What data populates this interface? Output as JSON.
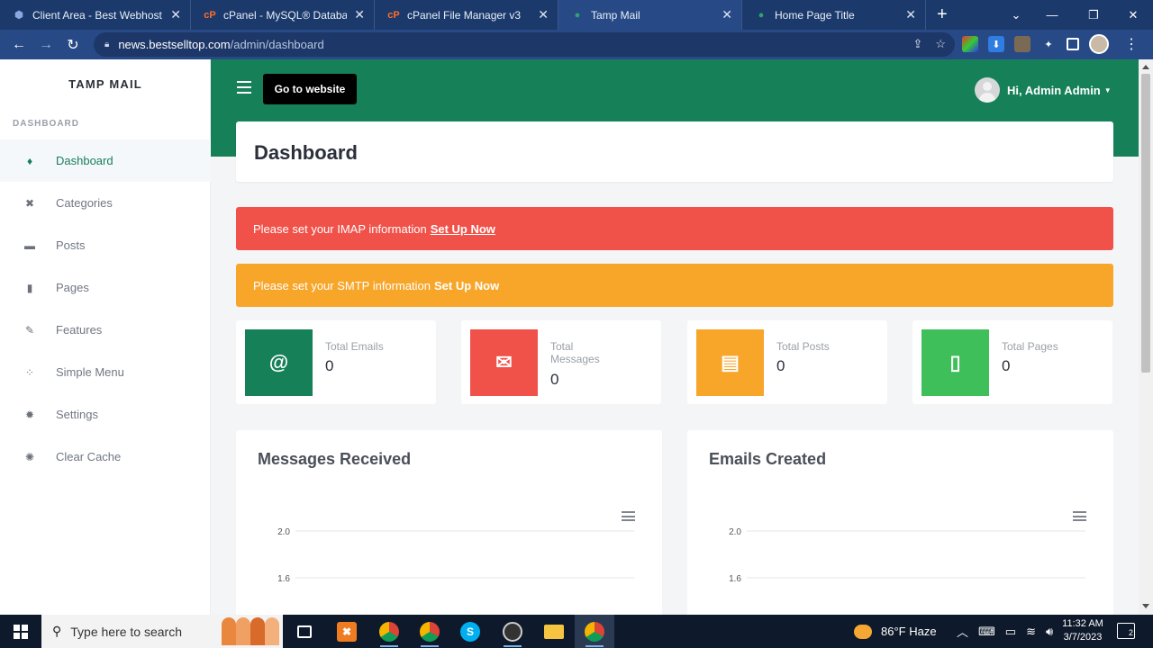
{
  "browser": {
    "tabs": [
      {
        "title": "Client Area - Best Webhost B",
        "icon": "shield-icon",
        "color": "#8aa7e0"
      },
      {
        "title": "cPanel - MySQL® Databases",
        "icon": "cpanel-icon",
        "color": "#ff6c2c"
      },
      {
        "title": "cPanel File Manager v3",
        "icon": "cpanel-icon",
        "color": "#ff6c2c"
      },
      {
        "title": "Tamp Mail",
        "icon": "mail-app-icon",
        "color": "#2fa36b"
      },
      {
        "title": "Home Page Title",
        "icon": "mail-app-icon",
        "color": "#2fa36b"
      }
    ],
    "url_host": "news.bestselltop.com",
    "url_path": "/admin/dashboard"
  },
  "sidebar": {
    "brand": "TAMP MAIL",
    "heading": "DASHBOARD",
    "items": [
      {
        "label": "Dashboard",
        "icon": "flame-icon"
      },
      {
        "label": "Categories",
        "icon": "tools-icon"
      },
      {
        "label": "Posts",
        "icon": "posts-icon"
      },
      {
        "label": "Pages",
        "icon": "page-icon"
      },
      {
        "label": "Features",
        "icon": "brush-icon"
      },
      {
        "label": "Simple Menu",
        "icon": "grid-icon"
      },
      {
        "label": "Settings",
        "icon": "gear-icon"
      },
      {
        "label": "Clear Cache",
        "icon": "clear-icon"
      }
    ]
  },
  "topbar": {
    "goto_label": "Go to website",
    "user_label": "Hi, Admin Admin"
  },
  "header": {
    "title": "Dashboard"
  },
  "alerts": {
    "imap_text": "Please set your IMAP information",
    "imap_link": "Set Up Now",
    "smtp_text": "Please set your SMTP information",
    "smtp_link": "Set Up Now"
  },
  "stats": [
    {
      "label": "Total Emails",
      "value": "0",
      "icon": "at-icon",
      "color": "#168059"
    },
    {
      "label": "Total Messages",
      "value": "0",
      "icon": "envelope-open-icon",
      "color": "#f0524a"
    },
    {
      "label": "Total Posts",
      "value": "0",
      "icon": "newspaper-icon",
      "color": "#f8a62a"
    },
    {
      "label": "Total Pages",
      "value": "0",
      "icon": "file-icon",
      "color": "#3fbf5a"
    }
  ],
  "chart_data": [
    {
      "type": "line",
      "title": "Messages Received",
      "yticks": [
        "2.0",
        "1.6"
      ],
      "ylabel": "",
      "series": []
    },
    {
      "type": "line",
      "title": "Emails Created",
      "yticks": [
        "2.0",
        "1.6"
      ],
      "ylabel": "",
      "series": []
    }
  ],
  "taskbar": {
    "search_placeholder": "Type here to search",
    "weather": "86°F  Haze",
    "time": "11:32 AM",
    "date": "3/7/2023",
    "notifications": "2"
  }
}
